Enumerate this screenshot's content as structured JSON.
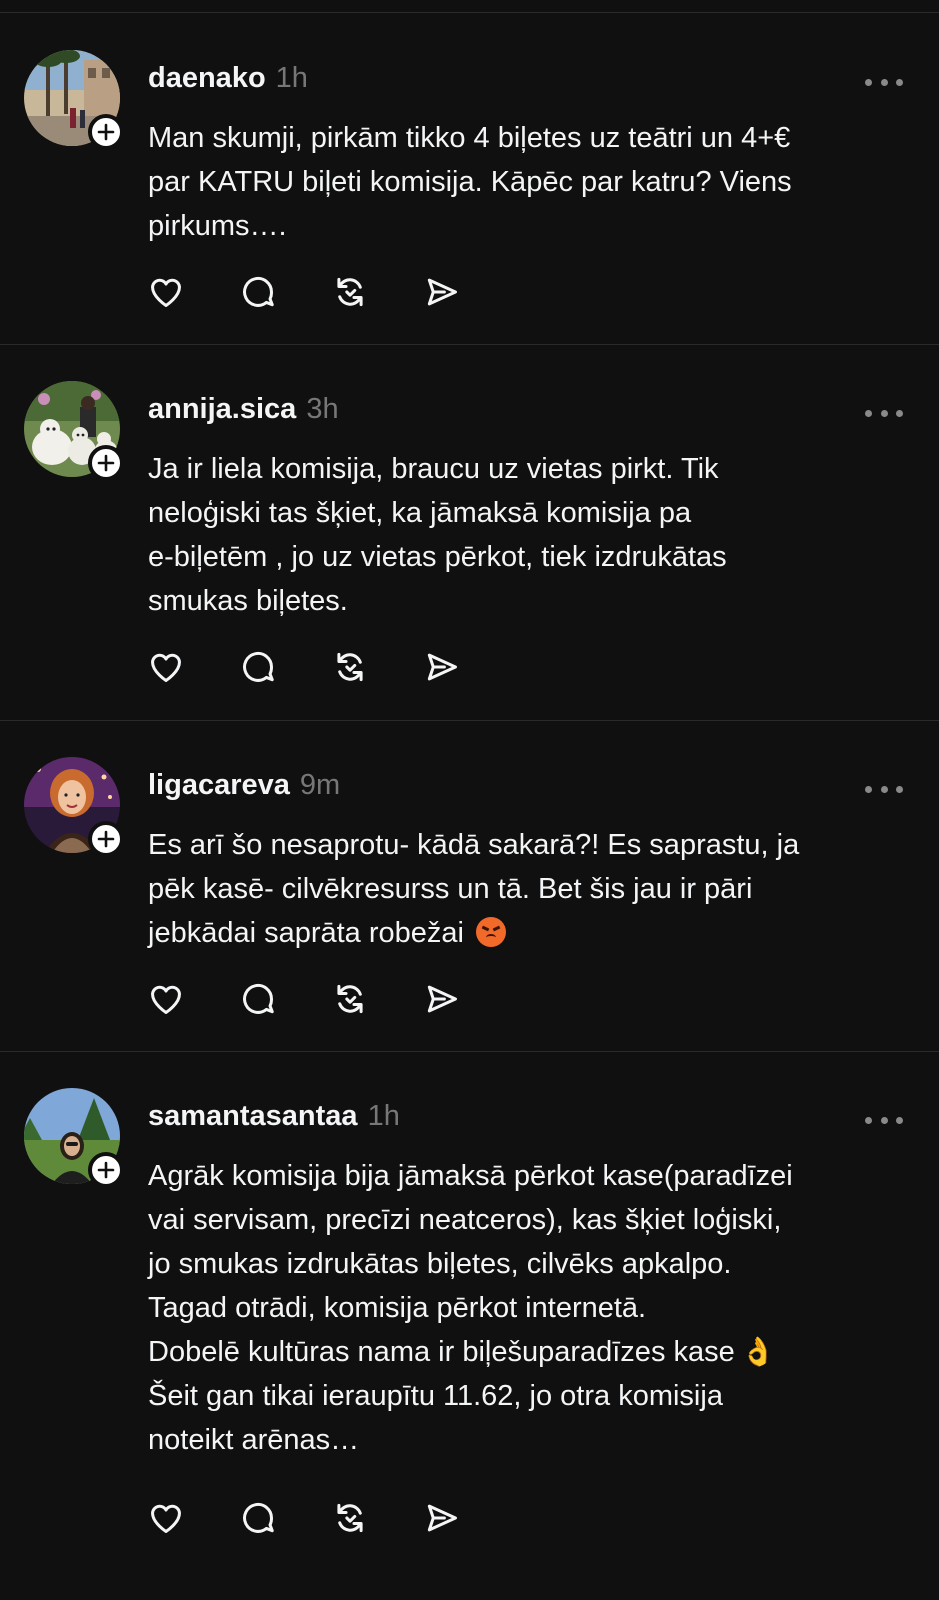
{
  "colors": {
    "background": "#101010",
    "text_primary": "#f3f5f7",
    "text_secondary": "#777777",
    "divider": "#2a2a2a",
    "icon": "#f3f5f7"
  },
  "posts": [
    {
      "username": "daenako",
      "time": "1h",
      "lines": [
        "Man skumji, pirkām tikko 4 biļetes uz teātri un 4+€",
        "par KATRU biļeti komisija. Kāpēc par katru? Viens",
        "pirkums…."
      ],
      "icons": [
        "heart-icon",
        "comment-icon",
        "repost-icon",
        "share-icon"
      ]
    },
    {
      "username": "annija.sica",
      "time": "3h",
      "lines": [
        "Ja ir liela komisija, braucu uz vietas pirkt. Tik",
        "neloģiski tas šķiet, ka jāmaksā komisija pa",
        "e-biļetēm , jo uz vietas pērkot, tiek izdrukātas",
        "smukas biļetes."
      ],
      "icons": [
        "heart-icon",
        "comment-icon",
        "repost-icon",
        "share-icon"
      ]
    },
    {
      "username": "ligacareva",
      "time": "9m",
      "lines": [
        "Es arī šo nesaprotu- kādā sakarā?! Es saprastu, ja",
        "pēk kasē- cilvēkresurss un tā. Bet šis jau ir pāri",
        "jebkādai saprāta robežai"
      ],
      "emoji": "angry-face",
      "icons": [
        "heart-icon",
        "comment-icon",
        "repost-icon",
        "share-icon"
      ]
    },
    {
      "username": "samantasantaa",
      "time": "1h",
      "lines": [
        "Agrāk komisija bija jāmaksā pērkot kase(paradīzei",
        "vai servisam, precīzi neatceros), kas šķiet loģiski,",
        "jo smukas izdrukātas biļetes, cilvēks apkalpo.",
        "Tagad otrādi, komisija pērkot internetā.",
        "Dobelē kultūras nama ir biļešuparadīzes kase",
        "Šeit gan tikai ieraupītu 11.62, jo otra komisija",
        "noteikt arēnas…"
      ],
      "emoji": "ok-hand",
      "icons": [
        "heart-icon",
        "comment-icon",
        "repost-icon",
        "share-icon"
      ]
    }
  ]
}
